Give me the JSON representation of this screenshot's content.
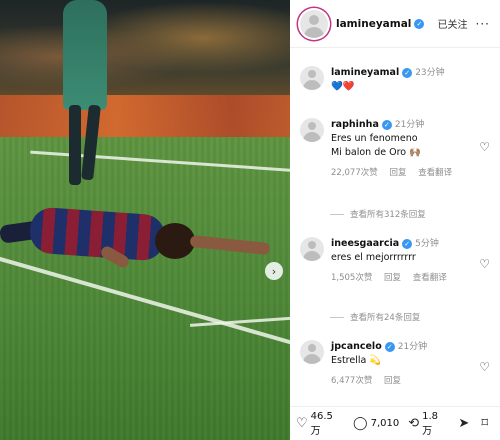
{
  "post": {
    "author": "lamineyamal",
    "follow_label": "已关注",
    "more_label": "···",
    "caption": "💙❤️",
    "caption_time": "23分钟"
  },
  "comments": [
    {
      "user": "raphinha",
      "time": "21分钟",
      "lines": [
        "Eres un fenomeno",
        "Mi balon de Oro 🙌🏽"
      ],
      "likes": "22,077次赞",
      "reply_label": "回复",
      "translate_label": "查看翻译",
      "view_replies": "查看所有312条回复"
    },
    {
      "user": "ineesgaarcia",
      "time": "5分钟",
      "lines": [
        "eres el mejorrrrrrr"
      ],
      "likes": "1,505次赞",
      "reply_label": "回复",
      "translate_label": "查看翻译",
      "view_replies": "查看所有24条回复"
    },
    {
      "user": "jpcancelo",
      "time": "21分钟",
      "lines": [
        "Estrella 💫"
      ],
      "likes": "6,477次赞",
      "reply_label": "回复"
    }
  ],
  "actions": {
    "likes": "46.5 万",
    "comments": "7,010",
    "reposts": "1.8 万"
  },
  "icons": {
    "like": "heart-icon",
    "comment": "comment-icon",
    "repost": "repost-icon",
    "share": "share-icon",
    "save": "bookmark-icon",
    "next": "chevron-right-icon"
  },
  "colors": {
    "verified": "#3897f0",
    "muted": "#8e8e8e"
  }
}
